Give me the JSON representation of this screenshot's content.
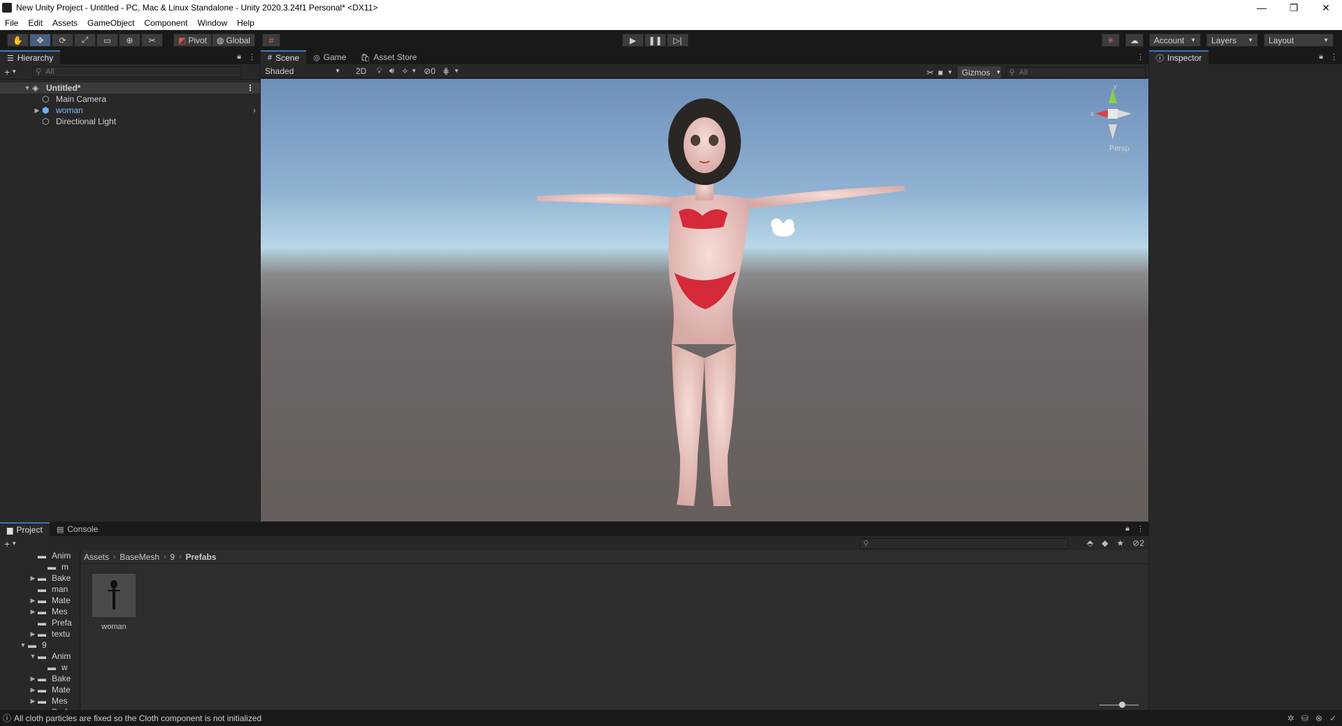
{
  "window": {
    "title": "New Unity Project - Untitled - PC, Mac & Linux Standalone - Unity 2020.3.24f1 Personal* <DX11>",
    "controls": [
      "—",
      "❐",
      "✕"
    ]
  },
  "menu": [
    "File",
    "Edit",
    "Assets",
    "GameObject",
    "Component",
    "Window",
    "Help"
  ],
  "toolbar": {
    "transform_tools": [
      "hand-icon",
      "move-icon",
      "rotate-icon",
      "scale-icon",
      "rect-icon",
      "transform-icon",
      "custom-tool-icon"
    ],
    "pivot": "Pivot",
    "global": "Global",
    "account": "Account",
    "layers": "Layers",
    "layout": "Layout"
  },
  "hierarchy": {
    "tab": "Hierarchy",
    "search_placeholder": "All",
    "root": "Untitled*",
    "items": [
      {
        "label": "Main Camera",
        "icon": "cube-icon"
      },
      {
        "label": "woman",
        "icon": "prefab-icon",
        "prefab": true
      },
      {
        "label": "Directional Light",
        "icon": "cube-icon"
      }
    ]
  },
  "scene": {
    "tabs": [
      "Scene",
      "Game",
      "Asset Store"
    ],
    "shading": "Shaded",
    "mode_2d": "2D",
    "hidden_count": "0",
    "gizmos": "Gizmos",
    "search_placeholder": "All",
    "persp": "Persp",
    "axis_x": "x",
    "axis_y": "y"
  },
  "inspector": {
    "tab": "Inspector"
  },
  "project": {
    "tabs": [
      "Project",
      "Console"
    ],
    "hidden_count": "2",
    "breadcrumb": [
      "Assets",
      "BaseMesh",
      "9",
      "Prefabs"
    ],
    "folders": [
      {
        "label": "Anim",
        "indent": 3,
        "arrow": ""
      },
      {
        "label": "m",
        "indent": 4,
        "arrow": ""
      },
      {
        "label": "Bake",
        "indent": 3,
        "arrow": "▶"
      },
      {
        "label": "man",
        "indent": 3,
        "arrow": ""
      },
      {
        "label": "Mate",
        "indent": 3,
        "arrow": "▶"
      },
      {
        "label": "Mes",
        "indent": 3,
        "arrow": "▶"
      },
      {
        "label": "Prefa",
        "indent": 3,
        "arrow": ""
      },
      {
        "label": "textu",
        "indent": 3,
        "arrow": "▶"
      },
      {
        "label": "9",
        "indent": 2,
        "arrow": "▼"
      },
      {
        "label": "Anim",
        "indent": 3,
        "arrow": "▼"
      },
      {
        "label": "w",
        "indent": 4,
        "arrow": ""
      },
      {
        "label": "Bake",
        "indent": 3,
        "arrow": "▶"
      },
      {
        "label": "Mate",
        "indent": 3,
        "arrow": "▶"
      },
      {
        "label": "Mes",
        "indent": 3,
        "arrow": "▶"
      },
      {
        "label": "Prefa",
        "indent": 3,
        "arrow": ""
      }
    ],
    "assets": [
      {
        "label": "woman"
      }
    ]
  },
  "status": {
    "message": "All cloth particles are fixed so the Cloth component is not initialized"
  }
}
